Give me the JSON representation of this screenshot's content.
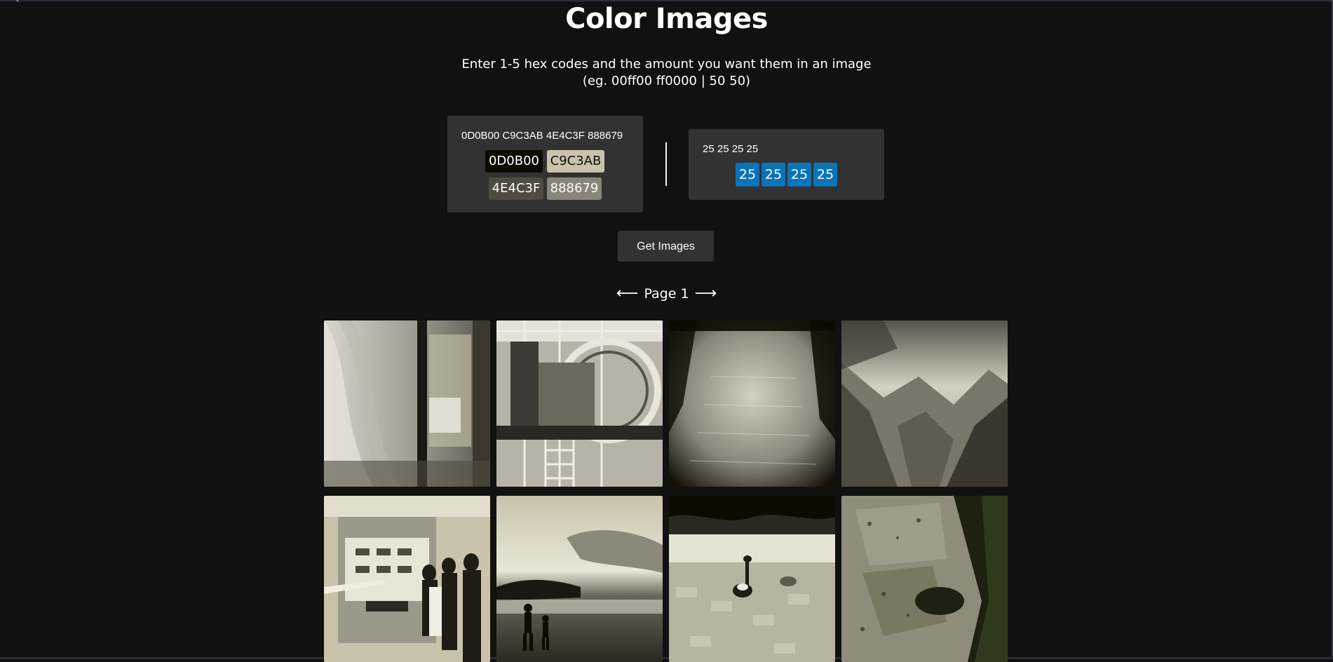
{
  "page": {
    "title": "Color Images",
    "subtitle_line1": "Enter 1-5 hex codes and the amount you want them in an image",
    "subtitle_line2": "(eg. 00ff00 ff0000 | 50 50)"
  },
  "hex_panel": {
    "input_value": "0D0B00 C9C3AB 4E4C3F 888679",
    "chips": [
      {
        "label": "0D0B00",
        "bg": "#0D0B00",
        "fg": "#ffffff"
      },
      {
        "label": "C9C3AB",
        "bg": "#C9C3AB",
        "fg": "#111111"
      },
      {
        "label": "4E4C3F",
        "bg": "#4E4C3F",
        "fg": "#ffffff"
      },
      {
        "label": "888679",
        "bg": "#888679",
        "fg": "#ffffff"
      }
    ]
  },
  "amount_panel": {
    "input_value": "25 25 25 25",
    "chips": [
      "25",
      "25",
      "25",
      "25"
    ],
    "chip_color": "#0a74b8"
  },
  "actions": {
    "get_images_label": "Get Images"
  },
  "pagination": {
    "prev_arrow": "⟵",
    "label": "Page 1",
    "next_arrow": "⟶"
  },
  "results": {
    "images": [
      {
        "subject": "curtain-interior-photo"
      },
      {
        "subject": "industrial-machine-photo"
      },
      {
        "subject": "river-water-photo"
      },
      {
        "subject": "mountain-canyon-photo"
      },
      {
        "subject": "museum-exhibit-photo"
      },
      {
        "subject": "beach-silhouettes-photo"
      },
      {
        "subject": "duck-on-path-photo"
      },
      {
        "subject": "mossy-rock-photo"
      }
    ]
  }
}
